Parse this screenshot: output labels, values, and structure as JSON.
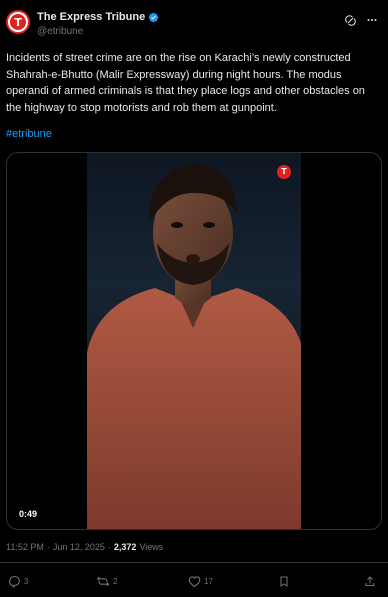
{
  "author": {
    "display_name": "The Express Tribune",
    "handle": "@etribune",
    "avatar_letter": "T",
    "avatar_color": "#e0221f",
    "verified": true
  },
  "post": {
    "text": "Incidents of street crime are on the rise on Karachi’s newly constructed Shahrah-e-Bhutto (Malir Expressway) during night hours. The modus operandi of armed criminals is that they place logs and other obstacles on the highway to stop motorists and rob them at gunpoint.",
    "hashtag": "#etribune"
  },
  "media": {
    "type": "video",
    "duration": "0:49",
    "channel_logo_letter": "T"
  },
  "meta": {
    "time": "11:52 PM",
    "separator": "·",
    "date": "Jun 12, 2025",
    "views_count": "2,372",
    "views_label": "Views"
  },
  "actions": {
    "replies": "3",
    "reposts": "2",
    "likes": "17"
  },
  "icons": {
    "top": [
      "grok-icon",
      "more-icon"
    ],
    "actions": [
      "reply-icon",
      "repost-icon",
      "like-icon",
      "bookmark-icon",
      "share-icon"
    ]
  },
  "colors": {
    "background": "#000000",
    "text": "#e7e9ea",
    "secondary": "#71767b",
    "link": "#1d9bf0",
    "border": "#2f3336"
  }
}
